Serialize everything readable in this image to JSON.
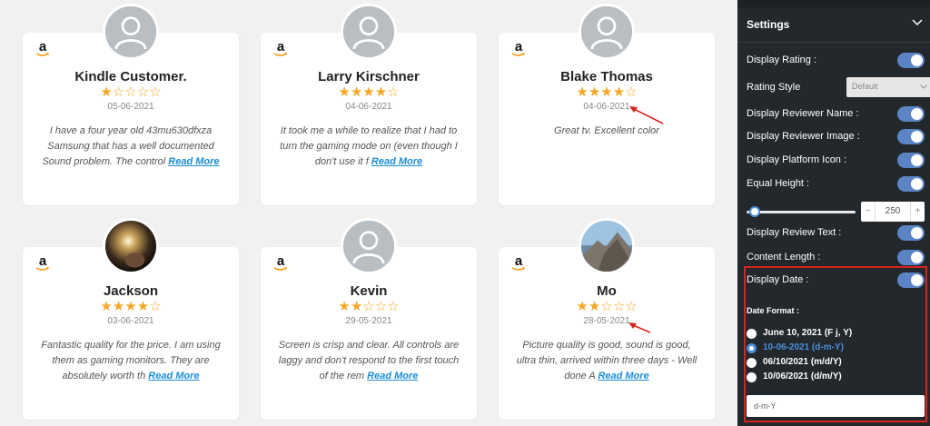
{
  "cards": [
    {
      "name": "Kindle Customer.",
      "rating": 1,
      "date": "05-06-2021",
      "text": "I have a four year old 43mu630dfxza Samsung that has a well documented Sound problem. The control",
      "read_more": "Read More",
      "avatar": "placeholder"
    },
    {
      "name": "Larry Kirschner",
      "rating": 4,
      "date": "04-06-2021",
      "text": "It took me a while to realize that I had to turn the gaming mode on (even though I don't use it f",
      "read_more": "Read More",
      "avatar": "placeholder"
    },
    {
      "name": "Blake Thomas",
      "rating": 4,
      "date": "04-06-2021",
      "text": "Great tv. Excellent color",
      "read_more": "",
      "avatar": "placeholder"
    },
    {
      "name": "Jackson",
      "rating": 4,
      "date": "03-06-2021",
      "text": "Fantastic quality for the price. I am using them as gaming monitors. They are absolutely worth th",
      "read_more": "Read More",
      "avatar": "photo-light"
    },
    {
      "name": "Kevin",
      "rating": 2,
      "date": "29-05-2021",
      "text": "Screen is crisp and clear. All controls are laggy and don't respond to the first touch of the rem",
      "read_more": "Read More",
      "avatar": "placeholder"
    },
    {
      "name": "Mo",
      "rating": 2,
      "date": "28-05-2021",
      "text": "Picture quality is good, sound is good, ultra thin, arrived within three days - Well done A",
      "read_more": "Read More",
      "avatar": "photo-mountain"
    }
  ],
  "platform_icon": "amazon-icon",
  "settings": {
    "title": "Settings",
    "display_rating": "Display Rating :",
    "rating_style_label": "Rating Style",
    "rating_style_value": "Default",
    "display_reviewer_name": "Display Reviewer Name :",
    "display_reviewer_image": "Display Reviewer Image :",
    "display_platform_icon": "Display Platform Icon :",
    "equal_height": "Equal Height :",
    "height_value": "250",
    "display_review_text": "Display Review Text :",
    "content_length": "Content Length :",
    "display_date": "Display Date :",
    "date_format_title": "Date Format :",
    "date_formats": [
      "June 10, 2021 (F j, Y)",
      "10-06-2021 (d-m-Y)",
      "06/10/2021 (m/d/Y)",
      "10/06/2021 (d/m/Y)"
    ],
    "selected_format_index": 1,
    "format_input_value": "d-m-Y"
  },
  "colors": {
    "star": "#f5a623",
    "toggle_on": "#5b84c4",
    "link": "#1a8cd8",
    "highlight_box": "#d6241d",
    "panel_bg": "#23282d"
  }
}
